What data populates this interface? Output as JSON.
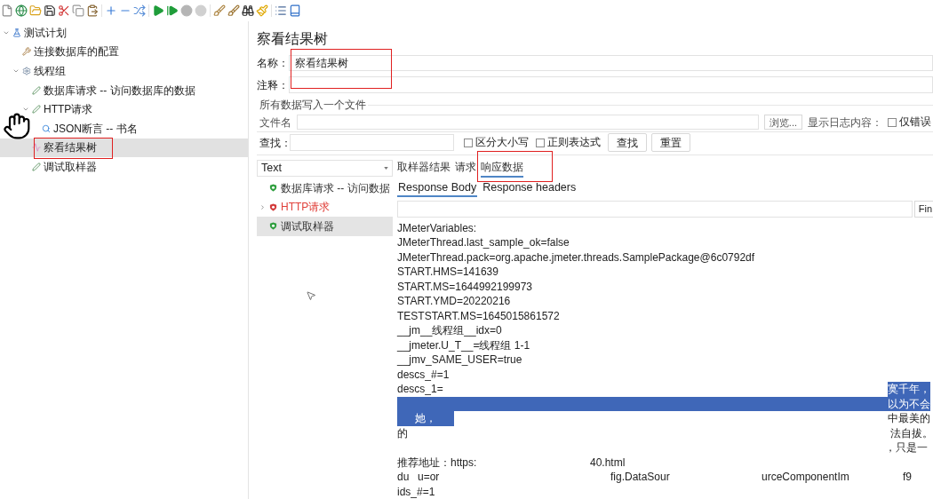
{
  "tree": [
    {
      "label": "测试计划",
      "kind": "plan",
      "expanded": true,
      "selected": false,
      "children": [
        {
          "label": "连接数据库的配置",
          "kind": "config",
          "selected": false
        },
        {
          "label": "线程组",
          "kind": "thread_group",
          "expanded": true,
          "selected": false,
          "children": [
            {
              "label": "数据库请求 -- 访问数据库的数据",
              "kind": "sampler",
              "selected": false
            },
            {
              "label": "HTTP请求",
              "kind": "sampler",
              "expanded": true,
              "selected": false,
              "children": [
                {
                  "label": "JSON断言 -- 书名",
                  "kind": "assertion",
                  "selected": false
                }
              ]
            },
            {
              "label": "察看结果树",
              "kind": "listener",
              "selected": true
            },
            {
              "label": "调试取样器",
              "kind": "sampler",
              "selected": false
            }
          ]
        }
      ]
    }
  ],
  "panel": {
    "title": "察看结果树",
    "name": {
      "label": "名称：",
      "value": "察看结果树"
    },
    "comment": {
      "label": "注释："
    },
    "file_group": {
      "title": "所有数据写入一个文件",
      "file_label": "文件名",
      "browse_button": "浏览...",
      "log_label": "显示日志内容：",
      "errors_only": {
        "label": "仅错误",
        "checked": false
      }
    },
    "search": {
      "label": "查找：",
      "options": [
        {
          "label": "区分大小写",
          "checked": false
        },
        {
          "label": "正则表达式",
          "checked": false
        }
      ],
      "buttons": [
        "查找",
        "重置"
      ]
    }
  },
  "results": {
    "renderer": {
      "value": "Text"
    },
    "samples": [
      {
        "label": "数据库请求 -- 访问数据",
        "failed": false,
        "collapsed": false,
        "selected": false
      },
      {
        "label": "HTTP请求",
        "failed": true,
        "collapsed": true,
        "selected": false
      },
      {
        "label": "调试取样器",
        "failed": false,
        "collapsed": false,
        "selected": true
      }
    ],
    "tabs": [
      {
        "label": "取样器结果",
        "selected": false
      },
      {
        "label": "请求",
        "selected": false
      },
      {
        "label": "响应数据",
        "selected": true
      }
    ],
    "body_tabs": [
      {
        "label": "Response Body",
        "selected": true
      },
      {
        "label": "Response headers",
        "selected": false
      }
    ],
    "find": {
      "button": "Fin"
    },
    "lines": [
      {
        "kind": "text",
        "selected": false,
        "text": "JMeterVariables:"
      },
      {
        "kind": "text",
        "selected": false,
        "text": "JMeterThread.last_sample_ok=false"
      },
      {
        "kind": "text",
        "selected": false,
        "text": "JMeterThread.pack=org.apache.jmeter.threads.SamplePackage@6c0792df"
      },
      {
        "kind": "text",
        "selected": false,
        "text": "START.HMS=141639"
      },
      {
        "kind": "text",
        "selected": false,
        "text": "START.MS=1644992199973"
      },
      {
        "kind": "text",
        "selected": false,
        "text": "START.YMD=20220216"
      },
      {
        "kind": "text",
        "selected": false,
        "text": "TESTSTART.MS=1645015861572"
      },
      {
        "kind": "text",
        "selected": false,
        "text": "__jm__线程组__idx=0"
      },
      {
        "kind": "text",
        "selected": false,
        "text": "__jmeter.U_T__=线程组 1-1"
      },
      {
        "kind": "text",
        "selected": false,
        "text": "__jmv_SAME_USER=true"
      },
      {
        "kind": "text",
        "selected": false,
        "text": "descs_#=1"
      },
      {
        "kind": "masked",
        "segments": [
          {
            "text": "descs_1=",
            "selected": false
          },
          {
            "text": "寞千年，",
            "selected": true
          }
        ]
      },
      {
        "kind": "masked",
        "segments": [
          {
            "text": "以为不会",
            "selected": true
          }
        ]
      },
      {
        "kind": "masked",
        "segments": [
          {
            "text": "她，",
            "selected": true
          },
          {
            "text": "中最美的",
            "selected": false
          }
        ]
      },
      {
        "kind": "masked",
        "segments": [
          {
            "text": "的",
            "selected": false
          },
          {
            "text": "法自拔。",
            "selected": false
          }
        ]
      },
      {
        "kind": "masked",
        "segments": [
          {
            "text": "，只是一",
            "selected": false
          }
        ]
      },
      {
        "kind": "masked",
        "segments": [
          {
            "text": "推荐地址：https:",
            "selected": false
          },
          {
            "text": "40.html",
            "selected": false
          }
        ]
      },
      {
        "kind": "masked",
        "segments": [
          {
            "text": "du",
            "selected": false
          },
          {
            "text": "u=or",
            "selected": false
          },
          {
            "text": "fig.DataSour",
            "selected": false
          },
          {
            "text": "urceComponentIm",
            "selected": false
          },
          {
            "text": "f9",
            "selected": false
          }
        ]
      },
      {
        "kind": "text",
        "selected": false,
        "text": "ids_#=1"
      }
    ]
  }
}
